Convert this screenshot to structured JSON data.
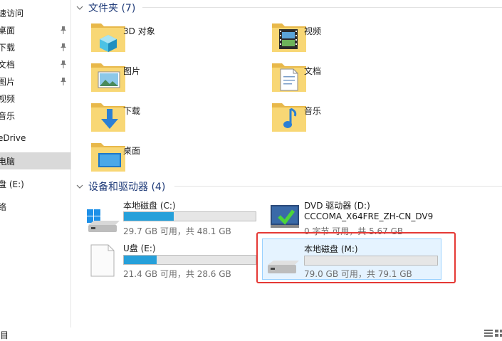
{
  "sidebar": {
    "items": [
      {
        "label": "速访问",
        "pinned": false
      },
      {
        "label": "桌面",
        "pinned": true
      },
      {
        "label": "下载",
        "pinned": true
      },
      {
        "label": "文档",
        "pinned": true
      },
      {
        "label": "图片",
        "pinned": true
      },
      {
        "label": "视频",
        "pinned": false
      },
      {
        "label": "音乐",
        "pinned": false
      },
      {
        "label": "eDrive",
        "pinned": false
      },
      {
        "label": "电脑",
        "pinned": false,
        "selected": true
      },
      {
        "label": "盘 (E:)",
        "pinned": false
      },
      {
        "label": "络",
        "pinned": false
      }
    ]
  },
  "folders_section": {
    "title": "文件夹 (7)",
    "items": [
      {
        "label": "3D 对象",
        "icon": "3d-objects-icon"
      },
      {
        "label": "视频",
        "icon": "videos-icon"
      },
      {
        "label": "图片",
        "icon": "pictures-icon"
      },
      {
        "label": "文档",
        "icon": "documents-icon"
      },
      {
        "label": "下载",
        "icon": "downloads-icon"
      },
      {
        "label": "音乐",
        "icon": "music-icon"
      },
      {
        "label": "桌面",
        "icon": "desktop-icon"
      }
    ]
  },
  "drives_section": {
    "title": "设备和驱动器 (4)",
    "drives": [
      {
        "name": "本地磁盘 (C:)",
        "info": "29.7 GB 可用，共 48.1 GB",
        "used_fraction": 0.38,
        "icon": "windows-drive-icon"
      },
      {
        "name": "DVD 驱动器 (D:)",
        "volume": "CCCOMA_X64FRE_ZH-CN_DV9",
        "info": "0 字节 可用，共 5.67 GB",
        "icon": "dvd-drive-icon"
      },
      {
        "name": "U盘 (E:)",
        "info": "21.4 GB 可用，共 28.6 GB",
        "used_fraction": 0.25,
        "icon": "usb-drive-icon"
      },
      {
        "name": "本地磁盘 (M:)",
        "info": "79.0 GB 可用，共 79.1 GB",
        "used_fraction": 0.0,
        "icon": "local-drive-icon"
      }
    ]
  },
  "status_bar": {
    "left_text": "目"
  },
  "colors": {
    "accent": "#26a0da",
    "header": "#1e3a78",
    "highlight": "#e53935",
    "folder": "#f8d775"
  }
}
